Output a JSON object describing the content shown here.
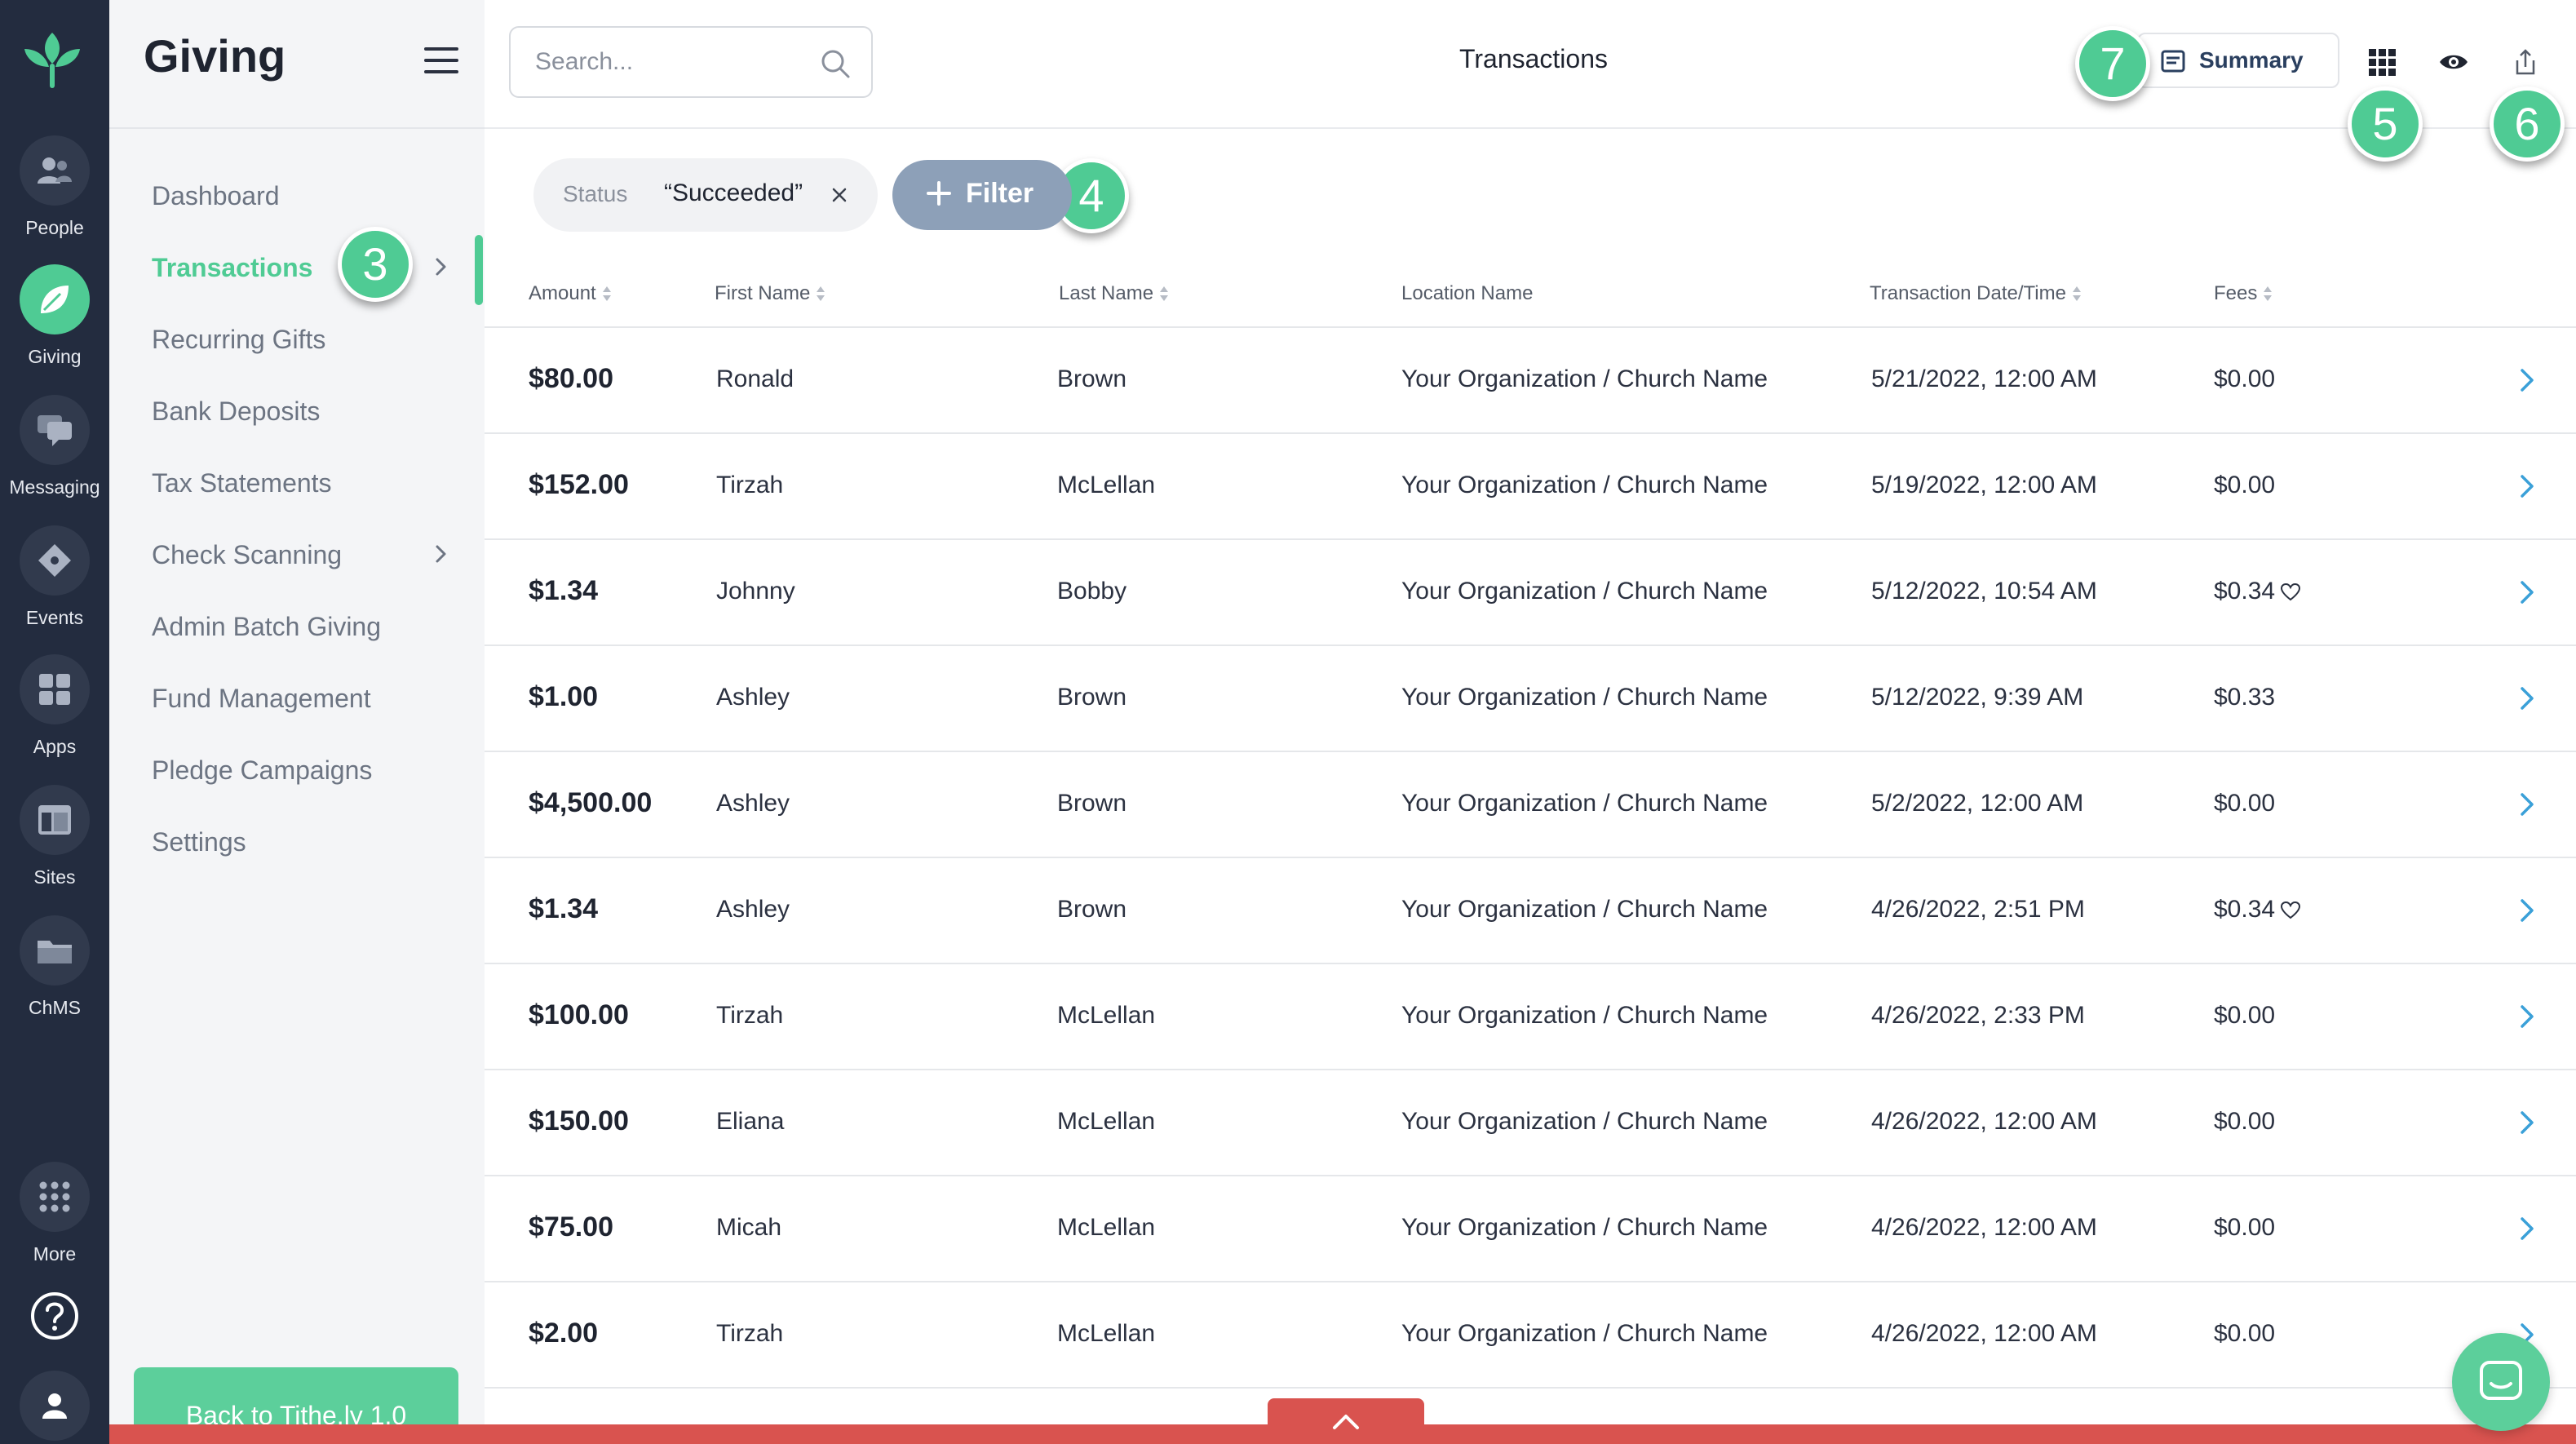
{
  "rail": {
    "logo_icon": "leaf-logo-icon",
    "items": [
      {
        "label": "People",
        "icon": "people-icon"
      },
      {
        "label": "Giving",
        "icon": "leaf-icon",
        "active": true
      },
      {
        "label": "Messaging",
        "icon": "chat-bubbles-icon"
      },
      {
        "label": "Events",
        "icon": "ticket-icon"
      },
      {
        "label": "Apps",
        "icon": "grid-icon"
      },
      {
        "label": "Sites",
        "icon": "layout-icon"
      },
      {
        "label": "ChMS",
        "icon": "folder-icon"
      }
    ],
    "more_label": "More",
    "help_icon": "help-icon",
    "profile_icon": "user-icon"
  },
  "sidebar": {
    "title": "Giving",
    "items": [
      {
        "label": "Dashboard"
      },
      {
        "label": "Transactions",
        "active": true,
        "has_chevron": true
      },
      {
        "label": "Recurring Gifts"
      },
      {
        "label": "Bank Deposits"
      },
      {
        "label": "Tax Statements"
      },
      {
        "label": "Check Scanning",
        "has_chevron": true
      },
      {
        "label": "Admin Batch Giving"
      },
      {
        "label": "Fund Management"
      },
      {
        "label": "Pledge Campaigns"
      },
      {
        "label": "Settings"
      }
    ],
    "back_button": "Back to Tithe.ly 1.0"
  },
  "header": {
    "search_placeholder": "Search...",
    "title": "Transactions",
    "summary_label": "Summary"
  },
  "badges": {
    "b3": "3",
    "b4": "4",
    "b5": "5",
    "b6": "6",
    "b7": "7"
  },
  "filters": {
    "chip_key": "Status",
    "chip_value": "“Succeeded”",
    "filter_label": "Filter"
  },
  "table": {
    "headers": {
      "amount": "Amount",
      "first_name": "First Name",
      "last_name": "Last Name",
      "location": "Location Name",
      "datetime": "Transaction Date/Time",
      "fees": "Fees"
    },
    "rows": [
      {
        "amount": "$80.00",
        "first": "Ronald",
        "last": "Brown",
        "location": "Your Organization / Church Name",
        "datetime": "5/21/2022, 12:00 AM",
        "fees": "$0.00",
        "heart": false
      },
      {
        "amount": "$152.00",
        "first": "Tirzah",
        "last": "McLellan",
        "location": "Your Organization / Church Name",
        "datetime": "5/19/2022, 12:00 AM",
        "fees": "$0.00",
        "heart": false
      },
      {
        "amount": "$1.34",
        "first": "Johnny",
        "last": "Bobby",
        "location": "Your Organization / Church Name",
        "datetime": "5/12/2022, 10:54 AM",
        "fees": "$0.34",
        "heart": true
      },
      {
        "amount": "$1.00",
        "first": "Ashley",
        "last": "Brown",
        "location": "Your Organization / Church Name",
        "datetime": "5/12/2022, 9:39 AM",
        "fees": "$0.33",
        "heart": false
      },
      {
        "amount": "$4,500.00",
        "first": "Ashley",
        "last": "Brown",
        "location": "Your Organization / Church Name",
        "datetime": "5/2/2022, 12:00 AM",
        "fees": "$0.00",
        "heart": false
      },
      {
        "amount": "$1.34",
        "first": "Ashley",
        "last": "Brown",
        "location": "Your Organization / Church Name",
        "datetime": "4/26/2022, 2:51 PM",
        "fees": "$0.34",
        "heart": true
      },
      {
        "amount": "$100.00",
        "first": "Tirzah",
        "last": "McLellan",
        "location": "Your Organization / Church Name",
        "datetime": "4/26/2022, 2:33 PM",
        "fees": "$0.00",
        "heart": false
      },
      {
        "amount": "$150.00",
        "first": "Eliana",
        "last": "McLellan",
        "location": "Your Organization / Church Name",
        "datetime": "4/26/2022, 12:00 AM",
        "fees": "$0.00",
        "heart": false
      },
      {
        "amount": "$75.00",
        "first": "Micah",
        "last": "McLellan",
        "location": "Your Organization / Church Name",
        "datetime": "4/26/2022, 12:00 AM",
        "fees": "$0.00",
        "heart": false
      },
      {
        "amount": "$2.00",
        "first": "Tirzah",
        "last": "McLellan",
        "location": "Your Organization / Church Name",
        "datetime": "4/26/2022, 12:00 AM",
        "fees": "$0.00",
        "heart": false
      }
    ]
  },
  "colors": {
    "accent": "#4fcb94",
    "rail_bg": "#232c3f",
    "link_blue": "#3aa0d8",
    "alert_red": "#d9534f",
    "filter_btn": "#8da0b8"
  }
}
